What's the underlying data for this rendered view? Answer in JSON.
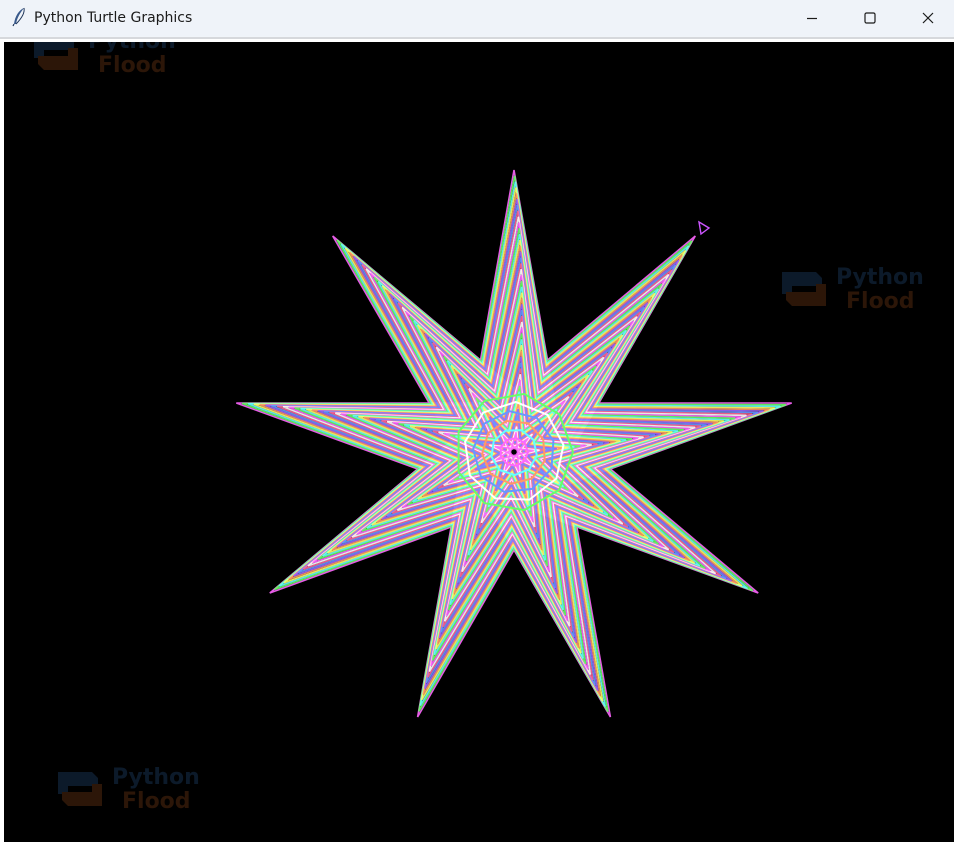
{
  "window": {
    "title": "Python Turtle Graphics",
    "icon": "feather-icon",
    "controls": [
      "minimize-icon",
      "maximize-icon",
      "close-icon"
    ]
  },
  "canvas": {
    "background": "#000000",
    "drawing": "nine-pointed star of multicolored turtle lines",
    "star_points": 9,
    "palette": [
      "#ff66ff",
      "#66ff66",
      "#66ffff",
      "#ffff66",
      "#ff9966",
      "#9966ff",
      "#6699ff",
      "#ff6699",
      "#ffffff"
    ]
  },
  "watermarks": [
    {
      "line1": "Python",
      "line2": "Flood"
    },
    {
      "line1": "Python",
      "line2": "Flood"
    },
    {
      "line1": "Python",
      "line2": "Flood"
    }
  ]
}
